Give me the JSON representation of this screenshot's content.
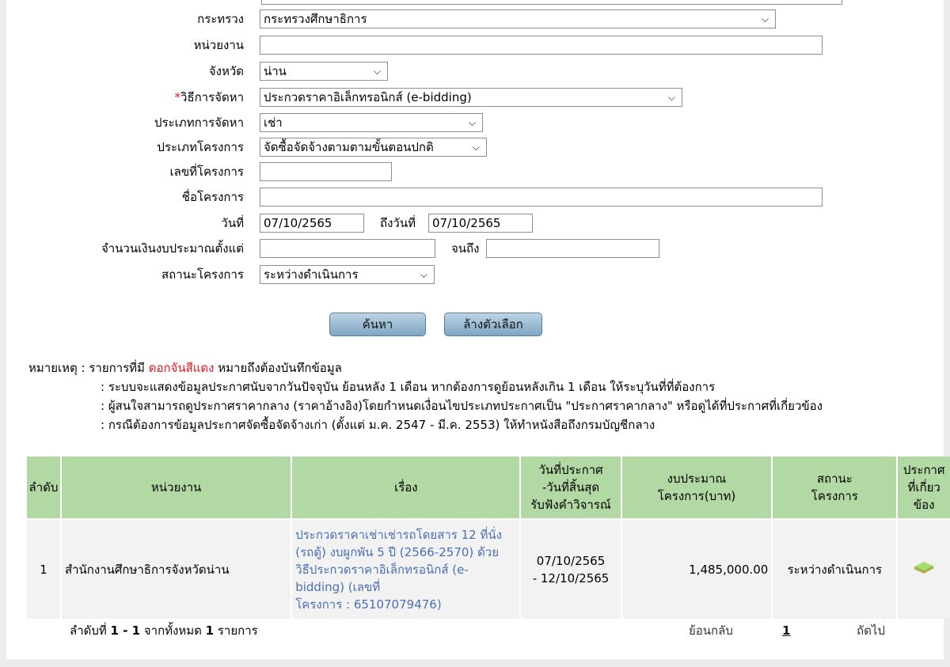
{
  "form": {
    "ministry": {
      "label": "กระทรวง",
      "value": "กระทรวงศึกษาธิการ"
    },
    "agency": {
      "label": "หน่วยงาน",
      "value": ""
    },
    "province": {
      "label": "จังหวัด",
      "value": "น่าน"
    },
    "method": {
      "required_mark": "*",
      "label": "วิธีการจัดหา",
      "value": "ประกวดราคาอิเล็กทรอนิกส์ (e-bidding)"
    },
    "procurement_type": {
      "label": "ประเภทการจัดหา",
      "value": "เช่า"
    },
    "project_type": {
      "label": "ประเภทโครงการ",
      "value": "จัดซื้อจัดจ้างตามตามขั้นตอนปกติ"
    },
    "project_no": {
      "label": "เลขที่โครงการ",
      "value": ""
    },
    "project_name": {
      "label": "ชื่อโครงการ",
      "value": ""
    },
    "date_from": {
      "label": "วันที่",
      "value": "07/10/2565"
    },
    "date_to": {
      "label": "ถึงวันที่",
      "value": "07/10/2565"
    },
    "budget_from": {
      "label": "จำนวนเงินงบประมาณตั้งแต่",
      "value": ""
    },
    "budget_to": {
      "label": "จนถึง",
      "value": ""
    },
    "status": {
      "label": "สถานะโครงการ",
      "value": "ระหว่างดำเนินการ"
    }
  },
  "buttons": {
    "search": "ค้นหา",
    "clear": "ล้างตัวเลือก"
  },
  "notes": {
    "prefix": "หมายเหตุ : รายการที่มี ",
    "highlight": "ดอกจันสีแดง",
    "suffix": " หมายถึงต้องบันทึกข้อมูล",
    "line2": ": ระบบจะแสดงข้อมูลประกาศนับจากวันปัจจุบัน ย้อนหลัง 1 เดือน หากต้องการดูย้อนหลังเกิน 1 เดือน ให้ระบุวันที่ที่ต้องการ",
    "line3": ": ผู้สนใจสามารถดูประกาศราคากลาง (ราคาอ้างอิง)โดยกำหนดเงื่อนไขประเภทประกาศเป็น \"ประกาศราคากลาง\" หรือดูได้ที่ประกาศที่เกี่ยวข้อง",
    "line4": ": กรณีต้องการข้อมูลประกาศจัดซื้อจัดจ้างเก่า (ตั้งแต่ ม.ค. 2547 - มี.ค. 2553) ให้ทำหนังสือถึงกรมบัญชีกลาง"
  },
  "table": {
    "headers": {
      "no": "ลำดับ",
      "agency": "หน่วยงาน",
      "subject": "เรื่อง",
      "dates_1": "วันที่ประกาศ",
      "dates_2": "-วันที่สิ้นสุด",
      "dates_3": "รับฟังคำวิจารณ์",
      "budget_1": "งบประมาณ",
      "budget_2": "โครงการ(บาท)",
      "status_1": "สถานะ",
      "status_2": "โครงการ",
      "related_1": "ประกาศ",
      "related_2": "ที่เกี่ยว",
      "related_3": "ข้อง"
    },
    "row": {
      "no": "1",
      "agency": "สำนักงานศึกษาธิการจังหวัดน่าน",
      "subject_1": "ประกวดราคาเช่าเช่ารถโดยสาร 12 ที่นั่ง",
      "subject_2": "(รถตู้) งบผูกพัน 5 ปี (2566-2570) ด้วย",
      "subject_3": "วิธีประกวดราคาอิเล็กทรอนิกส์ (e-",
      "subject_4": "bidding) (เลขที่",
      "subject_5": "โครงการ : 65107079476)",
      "date_1": "07/10/2565",
      "date_2": "- 12/10/2565",
      "budget": "1,485,000.00",
      "status": "ระหว่างดำเนินการ",
      "related_icon": "document-stack-icon"
    }
  },
  "footer": {
    "summary_prefix": "ลำดับที่ ",
    "range": "1 - 1",
    "summary_mid": " จากทั้งหมด ",
    "total": "1",
    "summary_suffix": " รายการ",
    "back": "ย้อนกลับ",
    "page": "1",
    "next": "ถัดไป"
  },
  "colors": {
    "header_bg": "#b2d8a3",
    "link": "#4a6fb3",
    "required": "#e8141b",
    "button": "#9ebdd6"
  }
}
